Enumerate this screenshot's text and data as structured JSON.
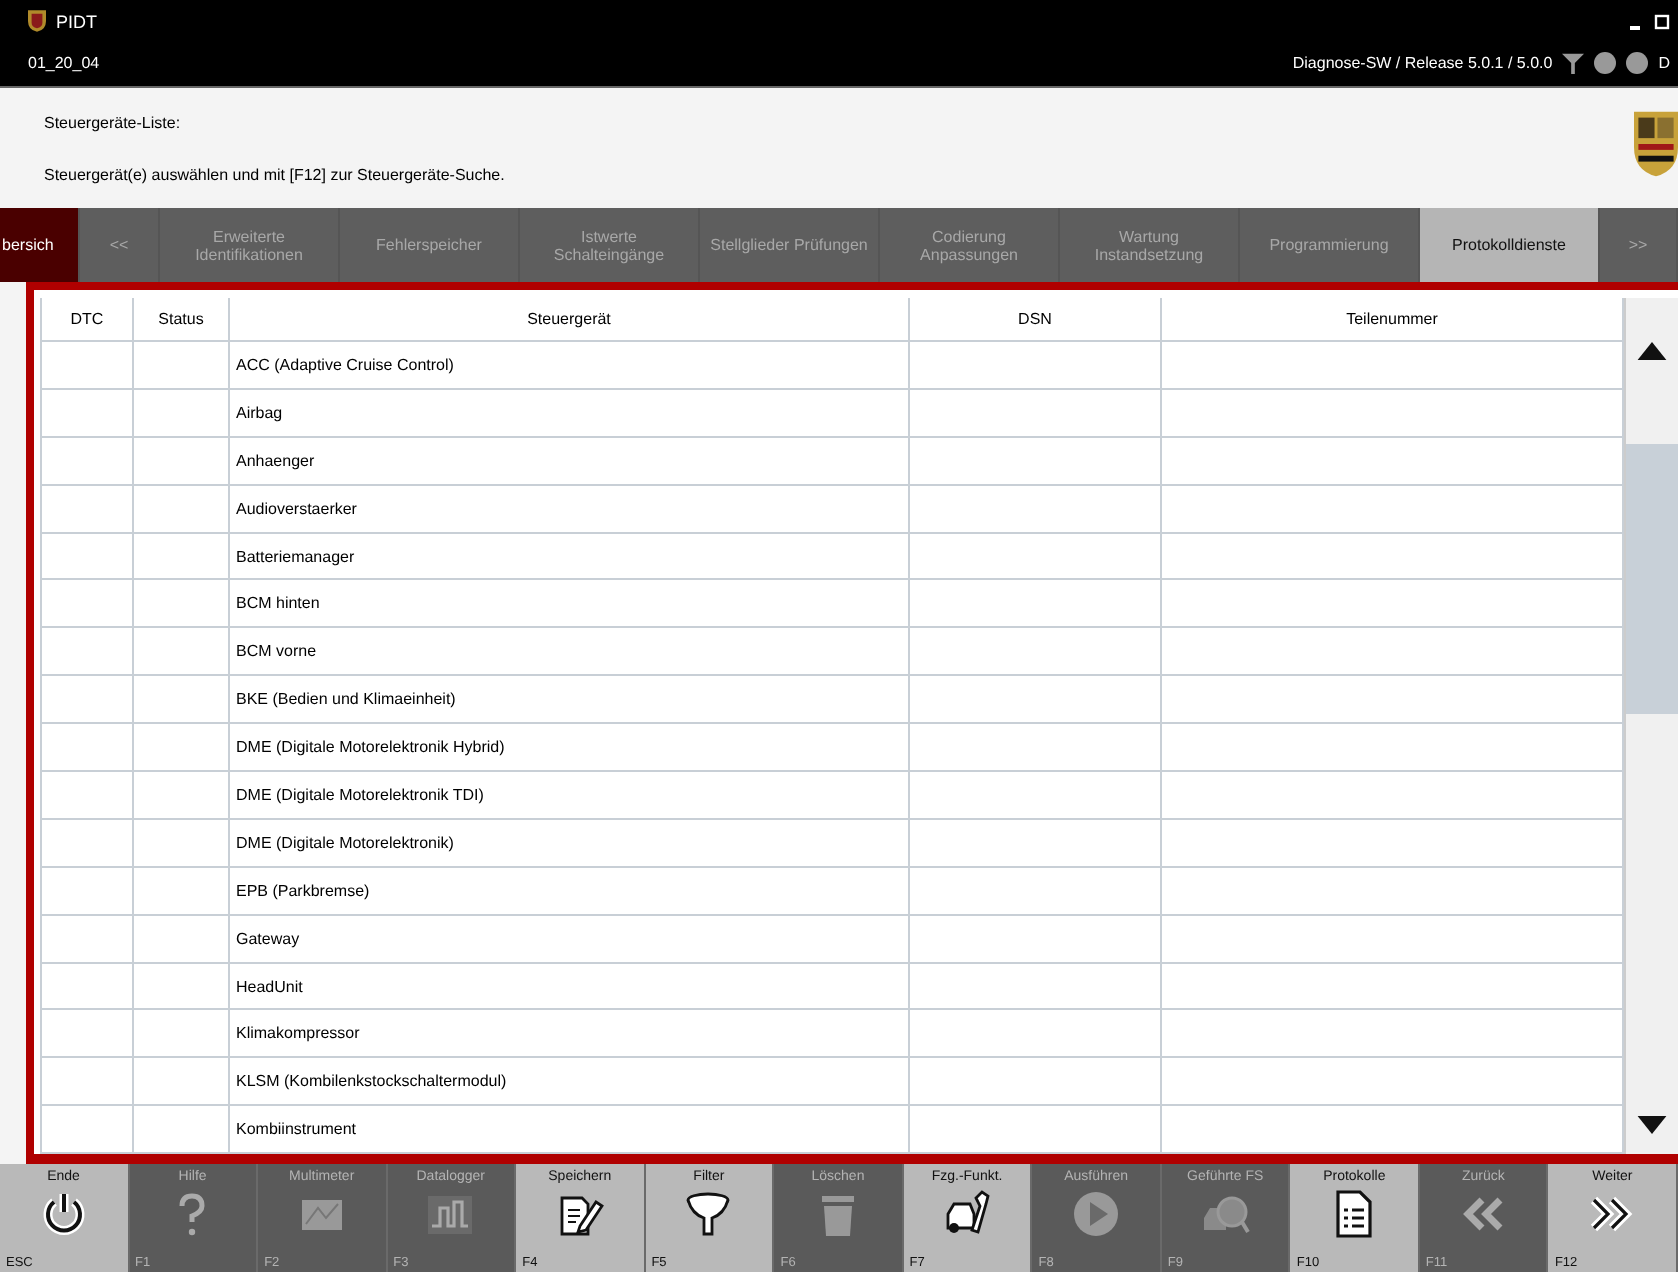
{
  "window": {
    "title": "PIDT",
    "subtitle": "01_20_04",
    "release": "Diagnose-SW / Release 5.0.1 / 5.0.0",
    "status_letter": "D"
  },
  "header": {
    "title": "Steuergeräte-Liste:",
    "instruction": "Steuergerät(e) auswählen und mit [F12] zur Steuergeräte-Suche."
  },
  "tabs": [
    {
      "label": "bersich",
      "selected": true,
      "disabled": false
    },
    {
      "label": "<<",
      "selected": false,
      "disabled": true
    },
    {
      "label": "Erweiterte Identifikationen",
      "selected": false,
      "disabled": true
    },
    {
      "label": "Fehlerspeicher",
      "selected": false,
      "disabled": true
    },
    {
      "label": "Istwerte Schalteingänge",
      "selected": false,
      "disabled": true
    },
    {
      "label": "Stellglieder Prüfungen",
      "selected": false,
      "disabled": true
    },
    {
      "label": "Codierung Anpassungen",
      "selected": false,
      "disabled": true
    },
    {
      "label": "Wartung Instandsetzung",
      "selected": false,
      "disabled": true
    },
    {
      "label": "Programmierung",
      "selected": false,
      "disabled": true
    },
    {
      "label": "Protokolldienste",
      "selected": false,
      "disabled": false
    },
    {
      "label": ">>",
      "selected": false,
      "disabled": true
    }
  ],
  "table": {
    "columns": [
      "DTC",
      "Status",
      "Steuergerät",
      "DSN",
      "Teilenummer"
    ],
    "rows": [
      "ACC (Adaptive Cruise Control)",
      "Airbag",
      "Anhaenger",
      "Audioverstaerker",
      "Batteriemanager",
      "BCM hinten",
      "BCM vorne",
      "BKE (Bedien und Klimaeinheit)",
      "DME (Digitale Motorelektronik Hybrid)",
      "DME (Digitale Motorelektronik TDI)",
      "DME (Digitale Motorelektronik)",
      "EPB (Parkbremse)",
      "Gateway",
      "HeadUnit",
      "Klimakompressor",
      "KLSM (Kombilenkstockschaltermodul)",
      "Kombiinstrument"
    ]
  },
  "toolbar": [
    {
      "label": "Ende",
      "key": "ESC",
      "disabled": false
    },
    {
      "label": "Hilfe",
      "key": "F1",
      "disabled": true
    },
    {
      "label": "Multimeter",
      "key": "F2",
      "disabled": true
    },
    {
      "label": "Datalogger",
      "key": "F3",
      "disabled": true
    },
    {
      "label": "Speichern",
      "key": "F4",
      "disabled": false
    },
    {
      "label": "Filter",
      "key": "F5",
      "disabled": false
    },
    {
      "label": "Löschen",
      "key": "F6",
      "disabled": true
    },
    {
      "label": "Fzg.-Funkt.",
      "key": "F7",
      "disabled": false
    },
    {
      "label": "Ausführen",
      "key": "F8",
      "disabled": true
    },
    {
      "label": "Geführte FS",
      "key": "F9",
      "disabled": true
    },
    {
      "label": "Protokolle",
      "key": "F10",
      "disabled": false
    },
    {
      "label": "Zurück",
      "key": "F11",
      "disabled": true
    },
    {
      "label": "Weiter",
      "key": "F12",
      "disabled": false
    }
  ]
}
